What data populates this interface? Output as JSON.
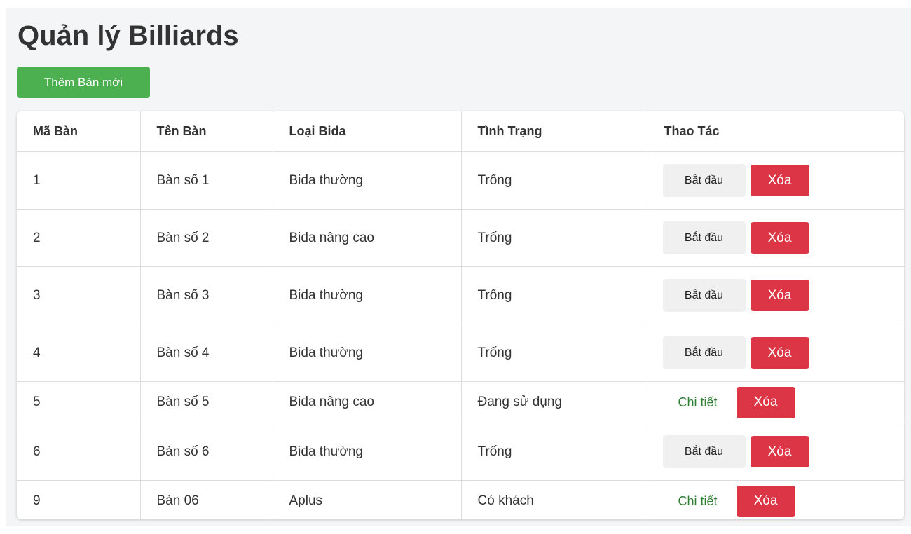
{
  "page": {
    "title": "Quản lý Billiards",
    "add_button_label": "Thêm Bàn mới"
  },
  "table": {
    "headers": [
      "Mã Bàn",
      "Tên Bàn",
      "Loại Bida",
      "Tình Trạng",
      "Thao Tác"
    ],
    "rows": [
      {
        "id": "1",
        "name": "Bàn số 1",
        "type": "Bida thường",
        "status": "Trống",
        "action": "Bắt đầu",
        "delete": "Xóa"
      },
      {
        "id": "2",
        "name": "Bàn số 2",
        "type": "Bida nâng cao",
        "status": "Trống",
        "action": "Bắt đầu",
        "delete": "Xóa"
      },
      {
        "id": "3",
        "name": "Bàn số 3",
        "type": "Bida thường",
        "status": "Trống",
        "action": "Bắt đầu",
        "delete": "Xóa"
      },
      {
        "id": "4",
        "name": "Bàn số 4",
        "type": "Bida thường",
        "status": "Trống",
        "action": "Bắt đầu",
        "delete": "Xóa"
      },
      {
        "id": "5",
        "name": "Bàn số 5",
        "type": "Bida nâng cao",
        "status": "Đang sử dụng",
        "action": "Chi tiết",
        "delete": "Xóa"
      },
      {
        "id": "6",
        "name": "Bàn số 6",
        "type": "Bida thường",
        "status": "Trống",
        "action": "Bắt đầu",
        "delete": "Xóa"
      },
      {
        "id": "9",
        "name": "Bàn 06",
        "type": "Aplus",
        "status": "Có khách",
        "action": "Chi tiết",
        "delete": "Xóa"
      }
    ]
  },
  "colors": {
    "add_button": "#4caf50",
    "delete_button": "#dc3545",
    "start_button": "#f0f0f0",
    "detail_link": "#2e7d32",
    "page_background": "#f4f5f7"
  }
}
